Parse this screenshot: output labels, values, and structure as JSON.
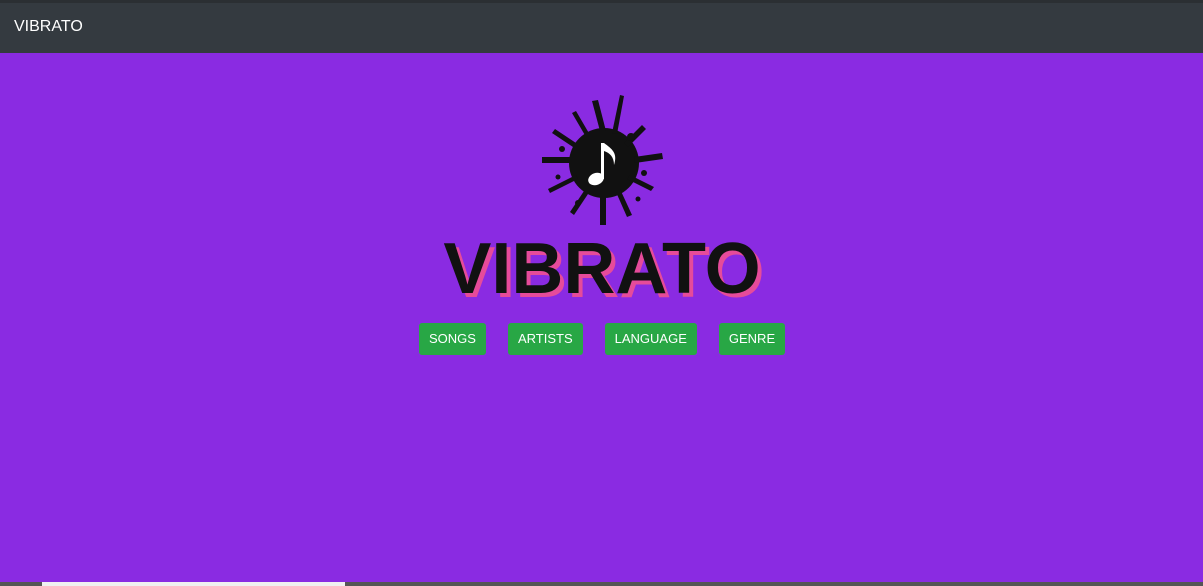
{
  "navbar": {
    "brand": "VIBRATO"
  },
  "hero": {
    "logo_text": "VIBRATO"
  },
  "buttons": [
    {
      "label": "SONGS"
    },
    {
      "label": "ARTISTS"
    },
    {
      "label": "LANGUAGE"
    },
    {
      "label": "GENRE"
    }
  ],
  "colors": {
    "background": "#8a2be2",
    "navbar": "#343a40",
    "button": "#28a745",
    "logo": "#111111",
    "logo_shadow": "#e64b9a"
  },
  "icons": {
    "logo_mark": "ink-splat-music-note-icon"
  }
}
